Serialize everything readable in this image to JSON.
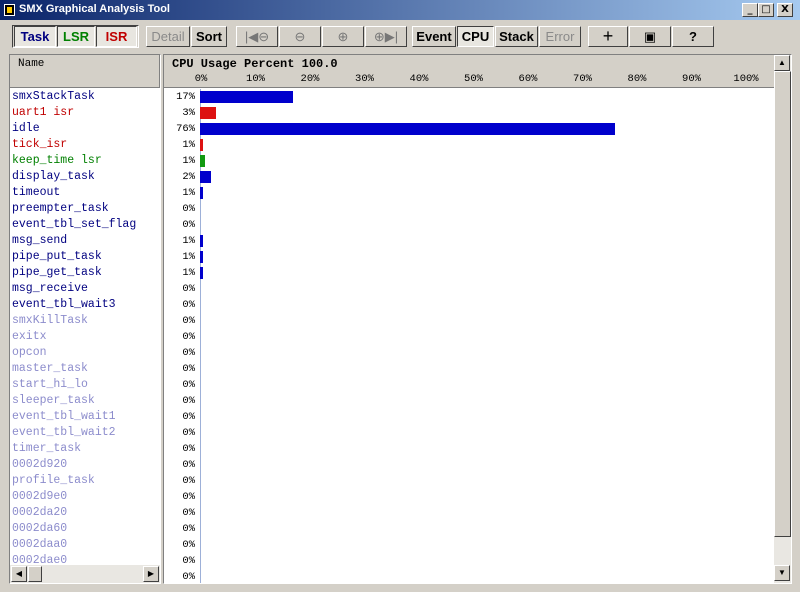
{
  "window": {
    "title": "SMX Graphical Analysis Tool",
    "min_glyph": "_",
    "max_glyph": "□",
    "close_glyph": "X"
  },
  "toolbar": {
    "task": "Task",
    "lsr": "LSR",
    "isr": "ISR",
    "detail": "Detail",
    "sort": "Sort",
    "zoom_first": "|◀⊖",
    "zoom_out": "⊖",
    "zoom_in": "⊕",
    "zoom_last": "⊕▶|",
    "event": "Event",
    "cpu": "CPU",
    "stack": "Stack",
    "error": "Error",
    "plus": "+",
    "page": "▣",
    "help": "?"
  },
  "colors": {
    "task": "#000080",
    "isr": "#c00000",
    "lsr": "#008000",
    "dimmed": "#8c8ccc",
    "bar_task": "#0000cc",
    "bar_isr": "#dd1111",
    "bar_lsr": "#119911"
  },
  "name_panel": {
    "header": "Name"
  },
  "chart": {
    "title": "CPU Usage Percent 100.0"
  },
  "chart_data": {
    "type": "bar",
    "title": "CPU Usage Percent 100.0",
    "orientation": "horizontal",
    "xlim": [
      0,
      100
    ],
    "ticks": [
      "0%",
      "10%",
      "20%",
      "30%",
      "40%",
      "50%",
      "60%",
      "70%",
      "80%",
      "90%",
      "100%"
    ],
    "rows": [
      {
        "name": "smxStackTask",
        "value": 17,
        "label": "17%",
        "kind": "task"
      },
      {
        "name": "uart1 isr",
        "value": 3,
        "label": "3%",
        "kind": "isr"
      },
      {
        "name": "idle",
        "value": 76,
        "label": "76%",
        "kind": "task"
      },
      {
        "name": "tick_isr",
        "value": 0.5,
        "label": "1%",
        "kind": "isr"
      },
      {
        "name": "keep_time lsr",
        "value": 1,
        "label": "1%",
        "kind": "lsr"
      },
      {
        "name": "display_task",
        "value": 2,
        "label": "2%",
        "kind": "task"
      },
      {
        "name": "timeout",
        "value": 0.5,
        "label": "1%",
        "kind": "task"
      },
      {
        "name": "preempter_task",
        "value": 0.1,
        "label": "0%",
        "kind": "task"
      },
      {
        "name": "event_tbl_set_flag",
        "value": 0.1,
        "label": "0%",
        "kind": "task"
      },
      {
        "name": "msg_send",
        "value": 0.5,
        "label": "1%",
        "kind": "task"
      },
      {
        "name": "pipe_put_task",
        "value": 0.5,
        "label": "1%",
        "kind": "task"
      },
      {
        "name": "pipe_get_task",
        "value": 0.5,
        "label": "1%",
        "kind": "task"
      },
      {
        "name": "msg_receive",
        "value": 0.1,
        "label": "0%",
        "kind": "task"
      },
      {
        "name": "event_tbl_wait3",
        "value": 0.1,
        "label": "0%",
        "kind": "task"
      },
      {
        "name": "smxKillTask",
        "value": 0.1,
        "label": "0%",
        "kind": "dimmed"
      },
      {
        "name": "exitx",
        "value": 0.1,
        "label": "0%",
        "kind": "dimmed"
      },
      {
        "name": "opcon",
        "value": 0.1,
        "label": "0%",
        "kind": "dimmed"
      },
      {
        "name": "master_task",
        "value": 0.1,
        "label": "0%",
        "kind": "dimmed"
      },
      {
        "name": "start_hi_lo",
        "value": 0.1,
        "label": "0%",
        "kind": "dimmed"
      },
      {
        "name": "sleeper_task",
        "value": 0.1,
        "label": "0%",
        "kind": "dimmed"
      },
      {
        "name": "event_tbl_wait1",
        "value": 0.1,
        "label": "0%",
        "kind": "dimmed"
      },
      {
        "name": "event_tbl_wait2",
        "value": 0.1,
        "label": "0%",
        "kind": "dimmed"
      },
      {
        "name": "timer_task",
        "value": 0.1,
        "label": "0%",
        "kind": "dimmed"
      },
      {
        "name": "0002d920",
        "value": 0.1,
        "label": "0%",
        "kind": "dimmed"
      },
      {
        "name": "profile_task",
        "value": 0.1,
        "label": "0%",
        "kind": "dimmed"
      },
      {
        "name": "0002d9e0",
        "value": 0.1,
        "label": "0%",
        "kind": "dimmed"
      },
      {
        "name": "0002da20",
        "value": 0.1,
        "label": "0%",
        "kind": "dimmed"
      },
      {
        "name": "0002da60",
        "value": 0.1,
        "label": "0%",
        "kind": "dimmed"
      },
      {
        "name": "0002daa0",
        "value": 0.1,
        "label": "0%",
        "kind": "dimmed"
      },
      {
        "name": "0002dae0",
        "value": 0.1,
        "label": "0%",
        "kind": "dimmed"
      },
      {
        "name": "",
        "value": 0.1,
        "label": "0%",
        "kind": "dimmed"
      }
    ]
  }
}
